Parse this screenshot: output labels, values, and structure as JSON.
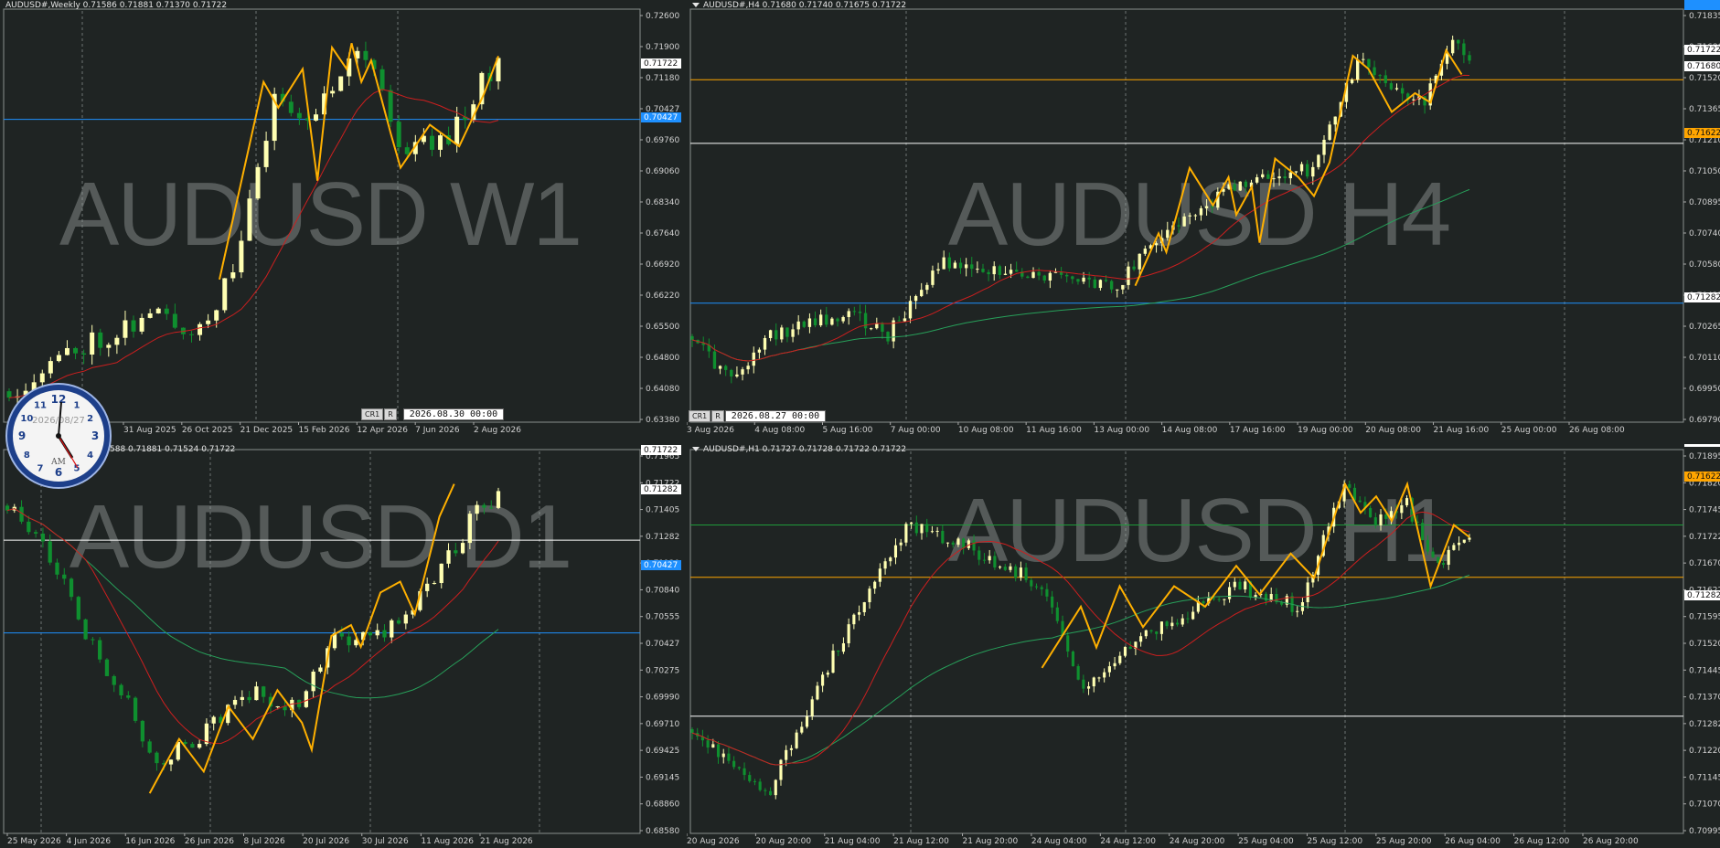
{
  "theme": {
    "bg": "#1f2423",
    "grid": "#9aa3a0",
    "text": "#e6e6e6",
    "axisText": "#d0d0d0",
    "bull": "#ffffb2",
    "bear": "#0f8f2f",
    "zigzag": "#ffb000",
    "ma_fast": "#cc1f1f",
    "ma_slow": "#27a05a",
    "hline_blue": "#1e90ff",
    "hline_orange": "#ffa500",
    "hline_white": "#ffffff",
    "hline_green": "#1f9a3a",
    "watermark": "#555a59"
  },
  "clock": {
    "date": "2026/08/27",
    "ampm": "AM",
    "numbers": [
      "12",
      "1",
      "2",
      "3",
      "4",
      "5",
      "6",
      "7",
      "8",
      "9",
      "10",
      "11"
    ]
  },
  "panes": [
    {
      "id": "w1",
      "header": "AUDUSD#,Weekly  0.71586 0.71881 0.71370 0.71722",
      "watermark": "AUDUSD W1",
      "xlabels": [
        "31 Aug 2025",
        "26 Oct 2025",
        "21 Dec 2025",
        "15 Feb 2026",
        "12 Apr 2026",
        "7 Jun 2026",
        "2 Aug 2026"
      ],
      "ylabels": [
        "0.72600",
        "0.71900",
        "0.71180",
        "0.70427",
        "0.69760",
        "0.69060",
        "0.68340",
        "0.67640",
        "0.66920",
        "0.66220",
        "0.65500",
        "0.64800",
        "0.64080",
        "0.63380"
      ],
      "price_tags": [
        {
          "text": "0.71722",
          "kind": "white"
        },
        {
          "text": "0.70427",
          "kind": "blue"
        }
      ],
      "ctrl": {
        "b1": "CR1",
        "b2": "R",
        "dt": "2026.08.30 00:00"
      },
      "chart_data": {
        "type": "candlestick",
        "ylim": [
          0.6338,
          0.7295
        ],
        "hlines": [
          {
            "value": 0.70427,
            "color": "blue"
          }
        ],
        "last": 0.71722
      }
    },
    {
      "id": "h4",
      "header": "AUDUSD#,H4  0.71680 0.71740 0.71675 0.71722",
      "watermark": "AUDUSD H4",
      "xlabels": [
        "3 Aug 2026",
        "4 Aug 08:00",
        "5 Aug 16:00",
        "7 Aug 00:00",
        "10 Aug 08:00",
        "11 Aug 16:00",
        "13 Aug 00:00",
        "14 Aug 08:00",
        "17 Aug 16:00",
        "19 Aug 00:00",
        "20 Aug 08:00",
        "21 Aug 16:00",
        "25 Aug 00:00",
        "26 Aug 08:00"
      ],
      "ylabels": [
        "0.71835",
        "0.71680",
        "0.71520",
        "0.71365",
        "0.71210",
        "0.71050",
        "0.70895",
        "0.70740",
        "0.70580",
        "0.70425",
        "0.70265",
        "0.70110",
        "0.69950",
        "0.69790"
      ],
      "price_tags": [
        {
          "text": "0.71722",
          "kind": "white"
        },
        {
          "text": "0.71680",
          "kind": "white"
        },
        {
          "text": "0.71622",
          "kind": "orange"
        },
        {
          "text": "0.71282",
          "kind": "white"
        },
        {
          "text": "0.70427",
          "kind": "blue"
        }
      ],
      "ctrl": {
        "b1": "CR1",
        "b2": "R",
        "dt": "2026.08.27 00:00"
      },
      "chart_data": {
        "type": "candlestick",
        "ylim": [
          0.6979,
          0.7199
        ],
        "hlines": [
          {
            "value": 0.71622,
            "color": "orange"
          },
          {
            "value": 0.71282,
            "color": "white"
          },
          {
            "value": 0.70427,
            "color": "blue"
          }
        ],
        "last": 0.71722
      }
    },
    {
      "id": "d1",
      "header": "588 0.71881 0.71524 0.71722",
      "watermark": "AUDUSD D1",
      "xlabels": [
        "25 May 2026",
        "4 Jun 2026",
        "16 Jun 2026",
        "26 Jun 2026",
        "8 Jul 2026",
        "20 Jul 2026",
        "30 Jul 2026",
        "11 Aug 2026",
        "21 Aug 2026"
      ],
      "ylabels": [
        "0.71965",
        "0.71722",
        "0.71405",
        "0.71282",
        "0.71120",
        "0.70840",
        "0.70555",
        "0.70427",
        "0.70275",
        "0.69990",
        "0.69710",
        "0.69425",
        "0.69145",
        "0.68860",
        "0.68580"
      ],
      "price_tags": [
        {
          "text": "0.71722",
          "kind": "white"
        },
        {
          "text": "0.71282",
          "kind": "white"
        },
        {
          "text": "0.70427",
          "kind": "blue"
        }
      ],
      "chart_data": {
        "type": "candlestick",
        "ylim": [
          0.6858,
          0.721
        ],
        "hlines": [
          {
            "value": 0.71282,
            "color": "white"
          },
          {
            "value": 0.70427,
            "color": "blue"
          }
        ],
        "last": 0.71722
      }
    },
    {
      "id": "h1",
      "header": "AUDUSD#,H1  0.71727 0.71728 0.71722 0.71722",
      "watermark": "AUDUSD H1",
      "xlabels": [
        "20 Aug 2026",
        "20 Aug 20:00",
        "21 Aug 04:00",
        "21 Aug 12:00",
        "21 Aug 20:00",
        "24 Aug 04:00",
        "24 Aug 12:00",
        "24 Aug 20:00",
        "25 Aug 04:00",
        "25 Aug 12:00",
        "25 Aug 20:00",
        "26 Aug 04:00",
        "26 Aug 12:00",
        "26 Aug 20:00"
      ],
      "ylabels": [
        "0.71895",
        "0.71820",
        "0.71745",
        "0.71722",
        "0.71670",
        "0.71622",
        "0.71595",
        "0.71520",
        "0.71445",
        "0.71370",
        "0.71282",
        "0.71220",
        "0.71145",
        "0.71070",
        "0.70995"
      ],
      "price_tags": [
        {
          "text": "0.71750",
          "kind": "green"
        },
        {
          "text": "0.71722",
          "kind": "white"
        },
        {
          "text": "0.71622",
          "kind": "orange"
        },
        {
          "text": "0.71282",
          "kind": "white"
        }
      ],
      "chart_data": {
        "type": "candlestick",
        "ylim": [
          0.70995,
          0.7193
        ],
        "hlines": [
          {
            "value": 0.7175,
            "color": "green"
          },
          {
            "value": 0.71622,
            "color": "orange"
          },
          {
            "value": 0.71282,
            "color": "white"
          }
        ],
        "last": 0.71722
      }
    }
  ]
}
